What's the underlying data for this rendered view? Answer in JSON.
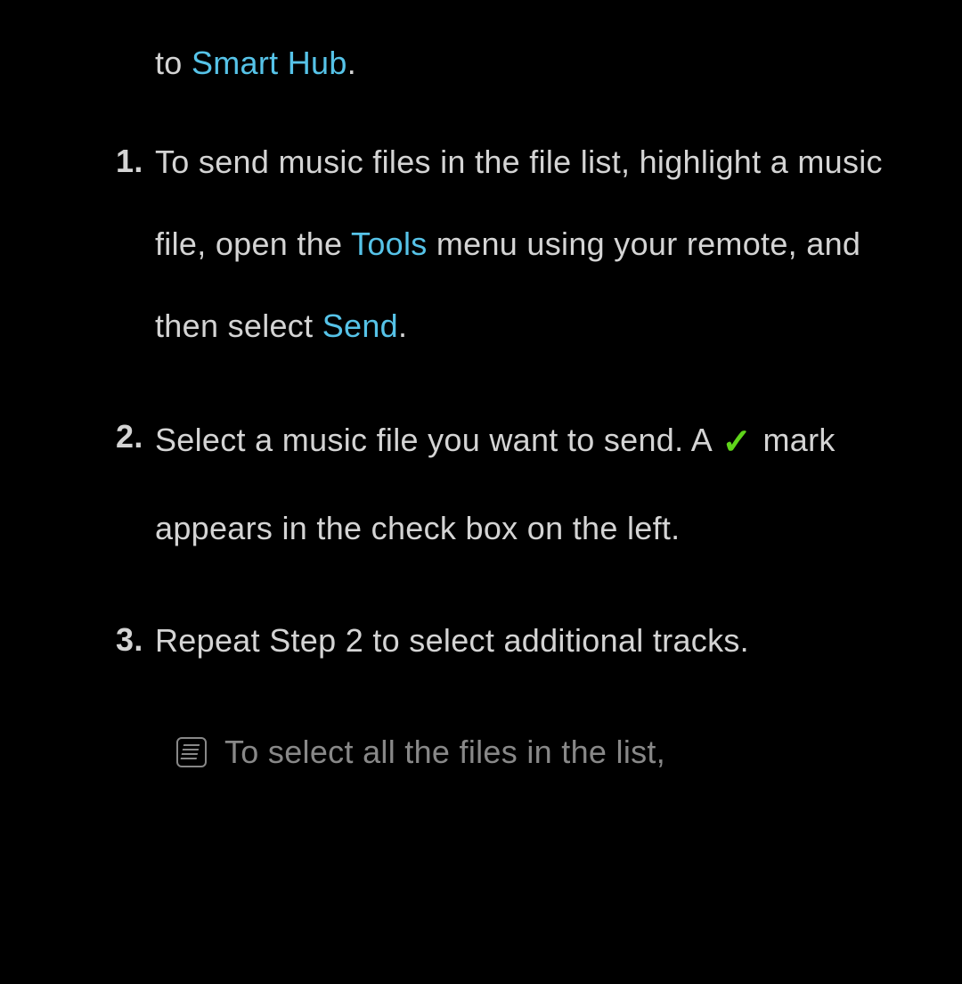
{
  "intro": {
    "prefix": "to ",
    "link": "Smart Hub",
    "suffix": "."
  },
  "steps": [
    {
      "number": "1.",
      "parts": [
        {
          "text": "To send music files in the file list, highlight a music file, open the ",
          "type": "text"
        },
        {
          "text": "Tools",
          "type": "accent"
        },
        {
          "text": " menu using your remote, and then select ",
          "type": "text"
        },
        {
          "text": "Send",
          "type": "accent"
        },
        {
          "text": ".",
          "type": "text"
        }
      ]
    },
    {
      "number": "2.",
      "parts": [
        {
          "text": "Select a music file you want to send. A ",
          "type": "text"
        },
        {
          "text": "c",
          "type": "check"
        },
        {
          "text": " mark appears in the check box on the left.",
          "type": "text"
        }
      ]
    },
    {
      "number": "3.",
      "parts": [
        {
          "text": "Repeat Step 2 to select additional tracks.",
          "type": "text"
        }
      ]
    }
  ],
  "note": {
    "text": "To select all the files in the list,"
  }
}
